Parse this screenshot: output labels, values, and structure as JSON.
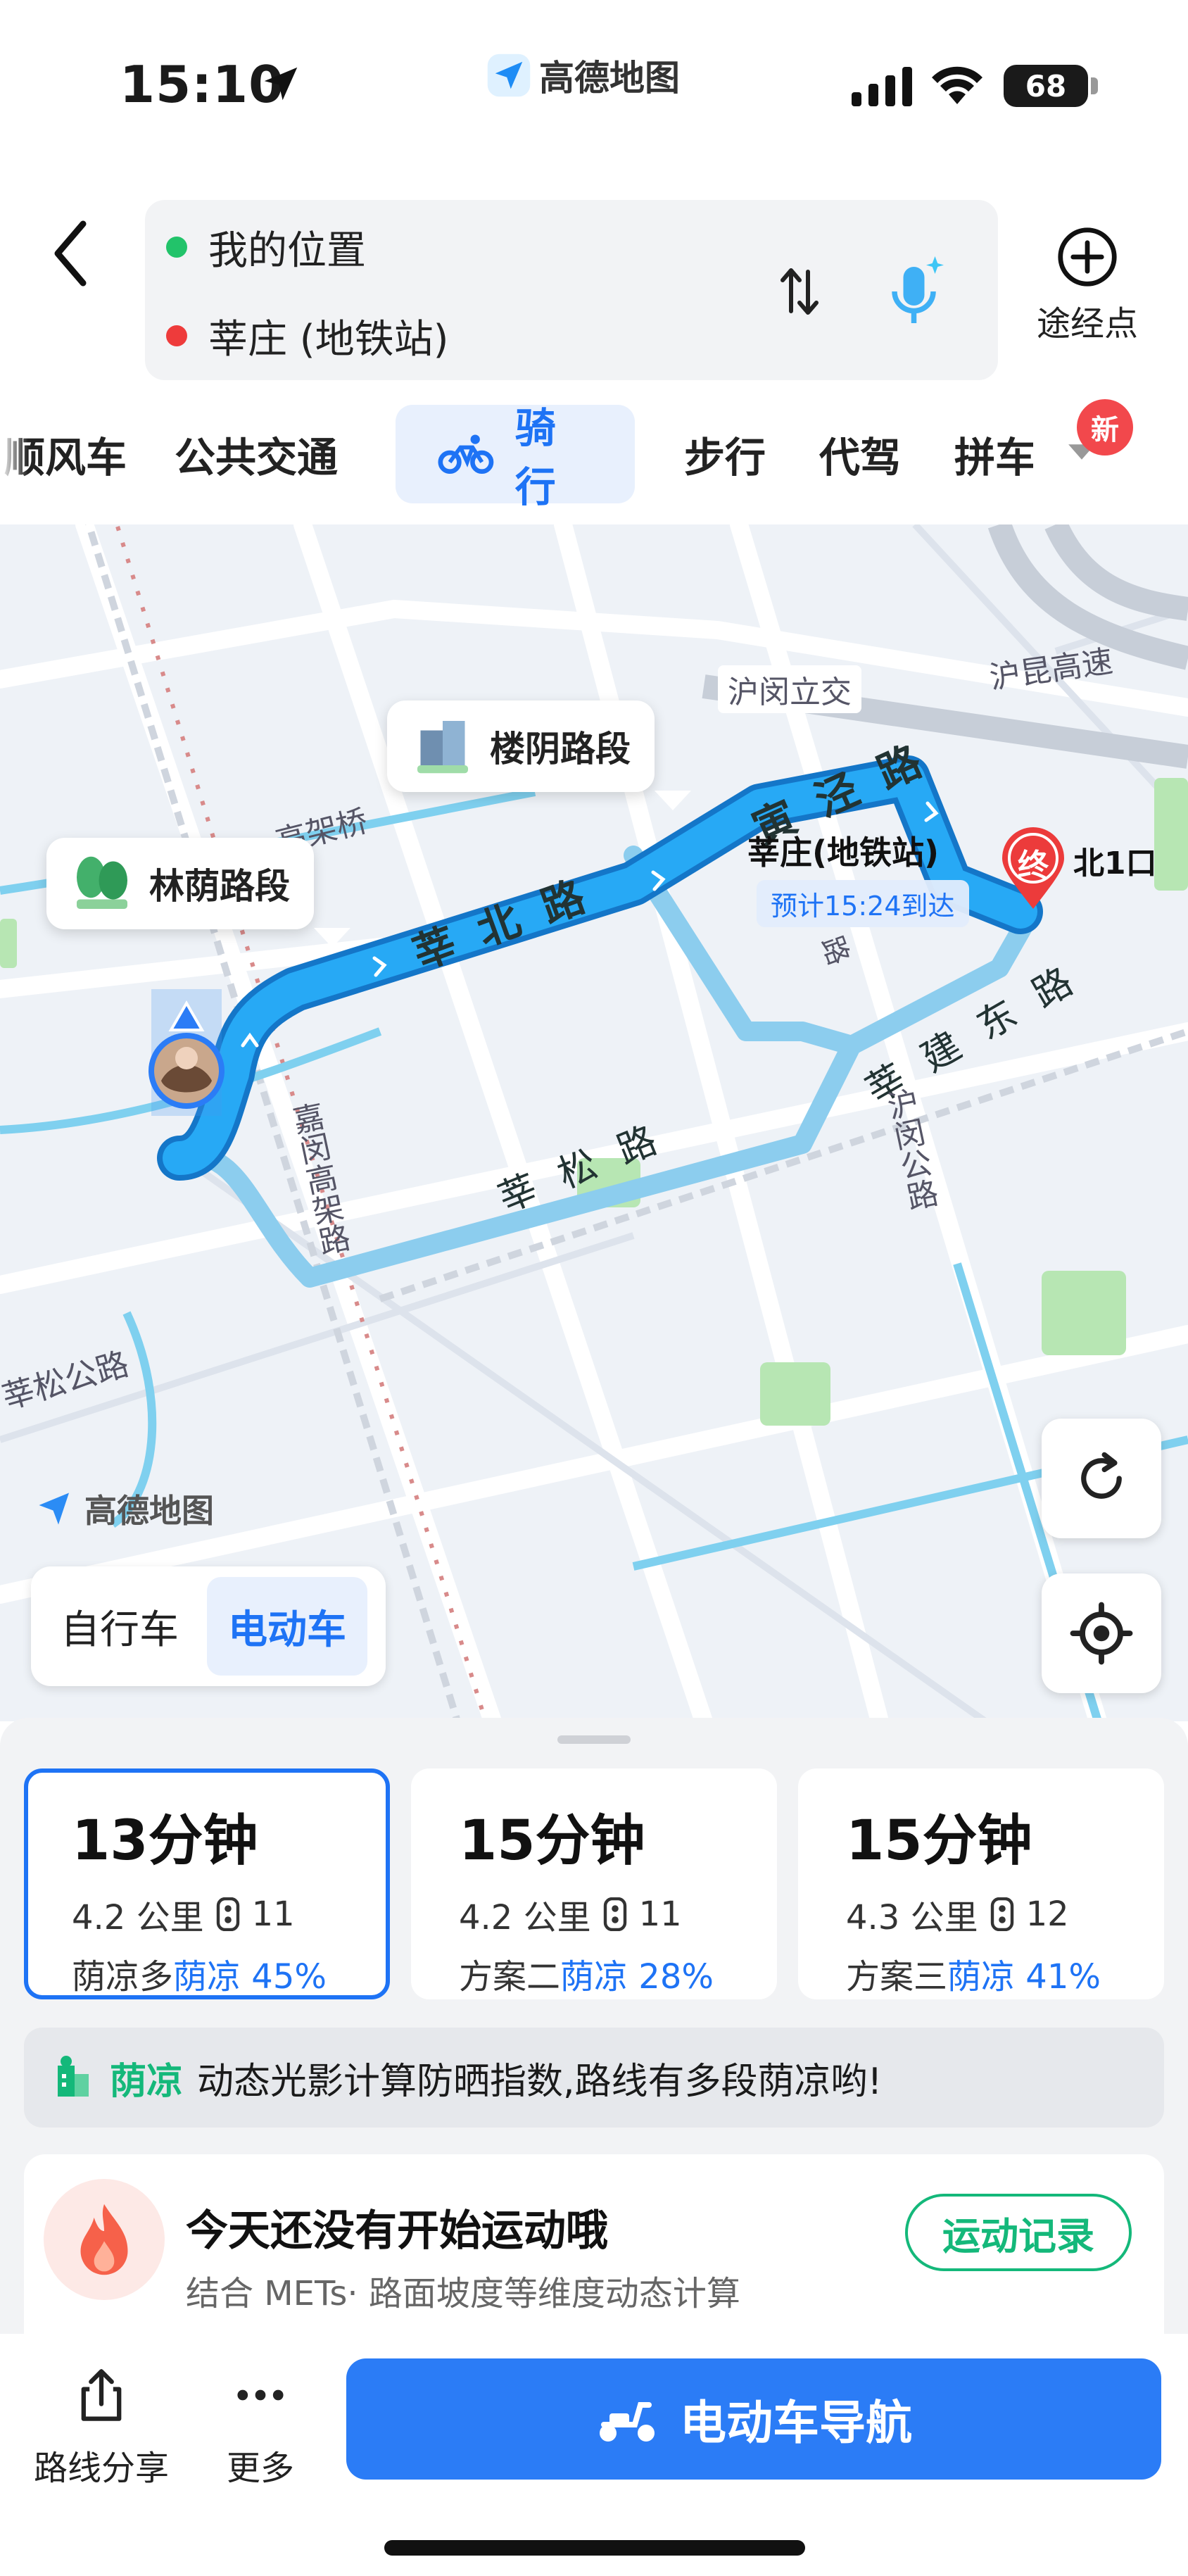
{
  "status_bar": {
    "time": "15:10",
    "app_name": "高德地图",
    "battery": "68"
  },
  "route": {
    "origin": "我的位置",
    "destination": "莘庄 (地铁站)",
    "origin_color": "#22c36a",
    "destination_color": "#ee3b3b",
    "waypoint_label": "途经点"
  },
  "mode_tabs": {
    "items": [
      "顺风车",
      "公共交通",
      "骑行",
      "步行",
      "代驾",
      "拼车"
    ],
    "active": "骑行",
    "new_badge": "新"
  },
  "map": {
    "callouts": {
      "linyin": "林荫路段",
      "louyin": "楼阴路段"
    },
    "labels": {
      "huminli": "沪闵立交",
      "humin_highway": "沪昆高速",
      "gaojiaqiao": "高架桥",
      "xinbeilu": "莘 北 路",
      "yinjinglu": "寅 泾 路",
      "xinsonglu": "莘 松 路",
      "xinjiandonglu": "莘 建 东 路",
      "jiaminviaduct": "嘉闵高架路",
      "huminlu": "沪闵公路",
      "xinsonglu_left": "莘松公路",
      "lu_small": "路"
    },
    "destination_label": "莘庄(地铁站)",
    "eta": "预计15:24到达",
    "end_pin_text": "终",
    "exit_label": "北1口",
    "watermark": "高德地图",
    "route_color": "#1a9ff0",
    "alt_route_color": "#8fd0f0"
  },
  "vehicle_toggle": {
    "options": [
      "自行车",
      "电动车"
    ],
    "active": "电动车"
  },
  "route_options": [
    {
      "time": "13分钟",
      "distance": "4.2 公里",
      "lights": "11",
      "tag": "荫凉多",
      "shade": "荫凉 45%"
    },
    {
      "time": "15分钟",
      "distance": "4.2 公里",
      "lights": "11",
      "tag": "方案二",
      "shade": "荫凉 28%"
    },
    {
      "time": "15分钟",
      "distance": "4.3 公里",
      "lights": "12",
      "tag": "方案三",
      "shade": "荫凉 41%"
    }
  ],
  "shade_banner": {
    "tag": "荫凉",
    "text": "动态光影计算防晒指数,路线有多段荫凉哟!"
  },
  "exercise": {
    "title": "今天还没有开始运动哦",
    "subtitle": "结合 METs· 路面坡度等维度动态计算",
    "button": "运动记录"
  },
  "actions": {
    "share": "路线分享",
    "more": "更多",
    "navigate": "电动车导航"
  },
  "colors": {
    "accent": "#1e73f5",
    "green": "#14b87a"
  }
}
